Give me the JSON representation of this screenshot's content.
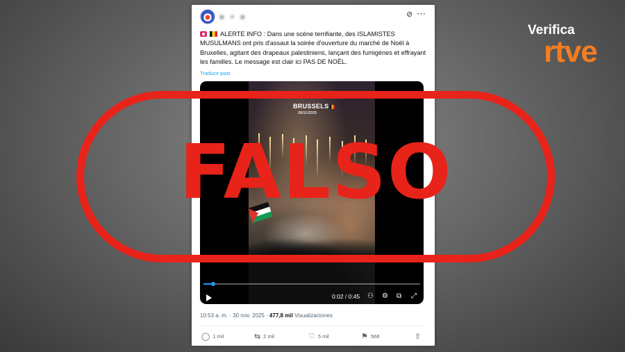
{
  "post": {
    "author_blurred": "■ ✦ ■",
    "alarm_emoji": "alarm-emoji",
    "flag_emoji": "belgium-flag-emoji",
    "text": "ALERTE INFO : Dans une scène terrifiante, des ISLAMISTES MUSULMANS ont pris d'assaut la soirée d'ouverture du marché de Noël à Bruxelles, agitant des drapeaux palestiniens, lançant des fumigènes et effrayant les familles. Le message est clair ici PAS DE NOËL.",
    "translate_label": "Traducir post",
    "timestamp": "10:53 a. m. · 30 nov. 2025 ·",
    "views_count": "477,8 mil",
    "views_label": "Visualizaciones"
  },
  "video": {
    "overlay_city": "BRUSSELS",
    "overlay_date": "28/11/2025",
    "time": "0:02 / 0:45",
    "progress_fraction": 0.044
  },
  "actions": {
    "replies": "1 mil",
    "reposts": "2 mil",
    "likes": "5 mil",
    "bookmarks": "568"
  },
  "stamp": {
    "text": "FALSO",
    "color": "#e8231a"
  },
  "brand": {
    "verifica": "Verifica",
    "rtve": "rtve",
    "rtve_color": "#f57d20"
  },
  "icons": {
    "grok": "grok-icon",
    "more": "more-icon",
    "play": "play-icon",
    "volume": "volume-icon",
    "settings": "gear-icon",
    "pip": "pip-icon",
    "fullscreen": "fullscreen-icon",
    "reply": "reply-icon",
    "repost": "repost-icon",
    "like": "heart-icon",
    "bookmark": "bookmark-icon",
    "share": "share-icon"
  }
}
